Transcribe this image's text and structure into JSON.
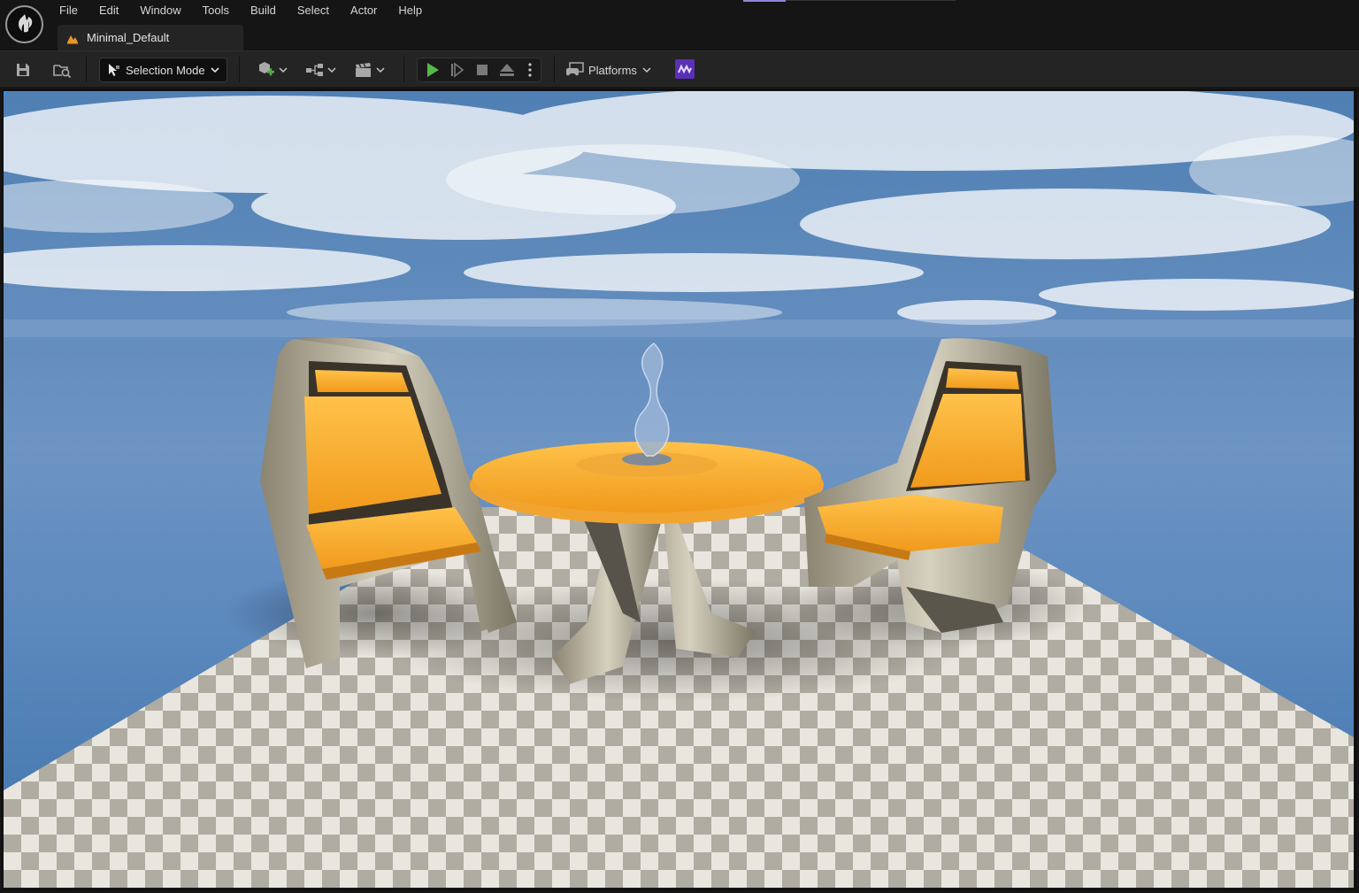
{
  "app": {
    "logo": "unreal-engine-logo"
  },
  "menu": [
    {
      "id": "file",
      "label": "File"
    },
    {
      "id": "edit",
      "label": "Edit"
    },
    {
      "id": "window",
      "label": "Window"
    },
    {
      "id": "tools",
      "label": "Tools"
    },
    {
      "id": "build",
      "label": "Build"
    },
    {
      "id": "select",
      "label": "Select"
    },
    {
      "id": "actor",
      "label": "Actor"
    },
    {
      "id": "help",
      "label": "Help"
    }
  ],
  "tab": {
    "label": "Minimal_Default",
    "icon": "level-icon",
    "icon_color": "#e8962a"
  },
  "toolbar": {
    "save_icon": "save-icon",
    "browse_icon": "content-browser-icon",
    "selection_mode_label": "Selection Mode",
    "add_icon": "add-actor-icon",
    "blueprint_icon": "blueprint-icon",
    "cinematics_icon": "cinematics-icon",
    "play_icon": "play-icon",
    "play_color": "#54b948",
    "advance_icon": "advance-frame-icon",
    "stop_icon": "stop-icon",
    "eject_icon": "eject-icon",
    "options_icon": "more-options-icon",
    "platforms_label": "Platforms",
    "plugin_color": "#5b2fb5"
  },
  "viewport": {
    "scene": "two orange lounge chairs and a round orange table with a glass sculpture on a checkered tile floor under a cloudy blue sky",
    "accent": "#3a8ad6"
  }
}
